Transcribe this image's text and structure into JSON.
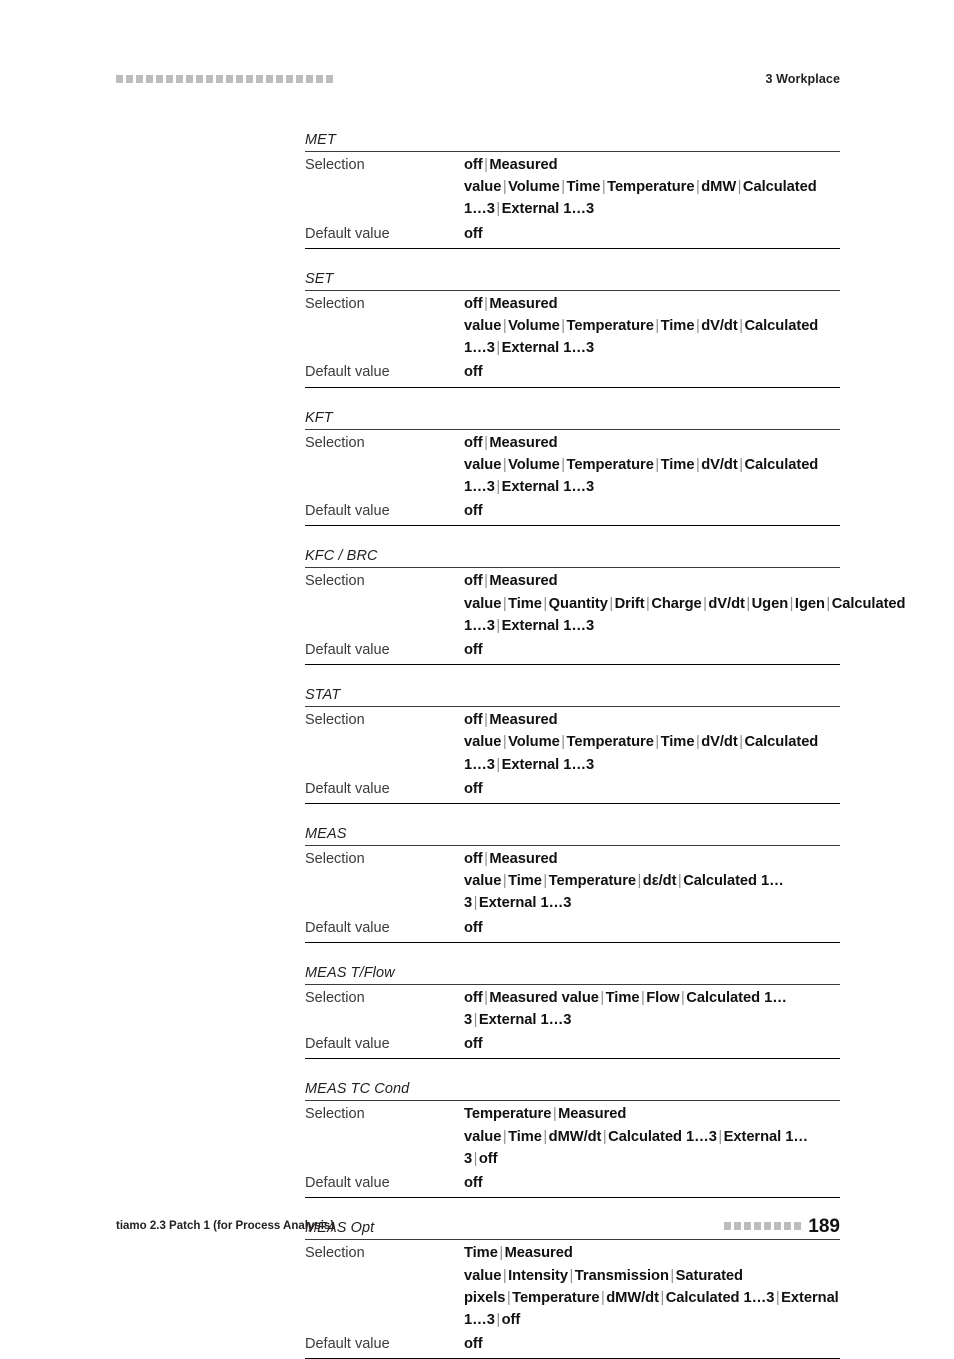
{
  "header": {
    "chapter": "3 Workplace",
    "decor_icon": "square-dots-rule-icon",
    "decor_count": 22
  },
  "footer": {
    "product": "tiamo 2.3 Patch 1 (for Process Analysis)",
    "page_number": "189",
    "decor_icon": "square-dots-rule-icon",
    "decor_count": 8
  },
  "labels": {
    "selection": "Selection",
    "default_value": "Default value"
  },
  "separator": "|",
  "blocks": [
    {
      "title": "MET",
      "selection_options": [
        "off",
        "Measured value",
        "Volume",
        "Time",
        "Temperature",
        "dMW",
        "Calculated 1…3",
        "External 1…3"
      ],
      "default_value": "off"
    },
    {
      "title": "SET",
      "selection_options": [
        "off",
        "Measured value",
        "Volume",
        "Temperature",
        "Time",
        "dV/dt",
        "Calculated 1…3",
        "External 1…3"
      ],
      "default_value": "off"
    },
    {
      "title": "KFT",
      "selection_options": [
        "off",
        "Measured value",
        "Volume",
        "Temperature",
        "Time",
        "dV/dt",
        "Calculated 1…3",
        "External 1…3"
      ],
      "default_value": "off"
    },
    {
      "title": "KFC / BRC",
      "selection_options": [
        "off",
        "Measured value",
        "Time",
        "Quantity",
        "Drift",
        "Charge",
        "dV/dt",
        "Ugen",
        "Igen",
        "Calculated 1…3",
        "External 1…3"
      ],
      "default_value": "off"
    },
    {
      "title": "STAT",
      "selection_options": [
        "off",
        "Measured value",
        "Volume",
        "Temperature",
        "Time",
        "dV/dt",
        "Calculated 1…3",
        "External 1…3"
      ],
      "default_value": "off"
    },
    {
      "title": "MEAS",
      "selection_options": [
        "off",
        "Measured value",
        "Time",
        "Temperature",
        "dε/dt",
        "Calculated 1…3",
        "External 1…3"
      ],
      "default_value": "off"
    },
    {
      "title": "MEAS T/Flow",
      "selection_options": [
        "off",
        "Measured value",
        "Time",
        "Flow",
        "Calculated 1…3",
        "External 1…3"
      ],
      "default_value": "off"
    },
    {
      "title": "MEAS TC Cond",
      "selection_options": [
        "Temperature",
        "Measured value",
        "Time",
        "dMW/dt",
        "Calculated 1…3",
        "External 1…3",
        "off"
      ],
      "default_value": "off"
    },
    {
      "title": "MEAS Opt",
      "selection_options": [
        "Time",
        "Measured value",
        "Intensity",
        "Transmission",
        "Saturated pixels",
        "Temperature",
        "dMW/dt",
        "Calculated 1…3",
        "External 1…3",
        "off"
      ],
      "default_value": "off"
    }
  ],
  "colors": {
    "text": "#231f20",
    "value_text": "#111111",
    "label_text": "#3b3b3b",
    "separator": "#8f8f8f",
    "decor": "#bdbdbd",
    "rule_thin": "#3a3a3a",
    "rule_thick": "#000000"
  }
}
